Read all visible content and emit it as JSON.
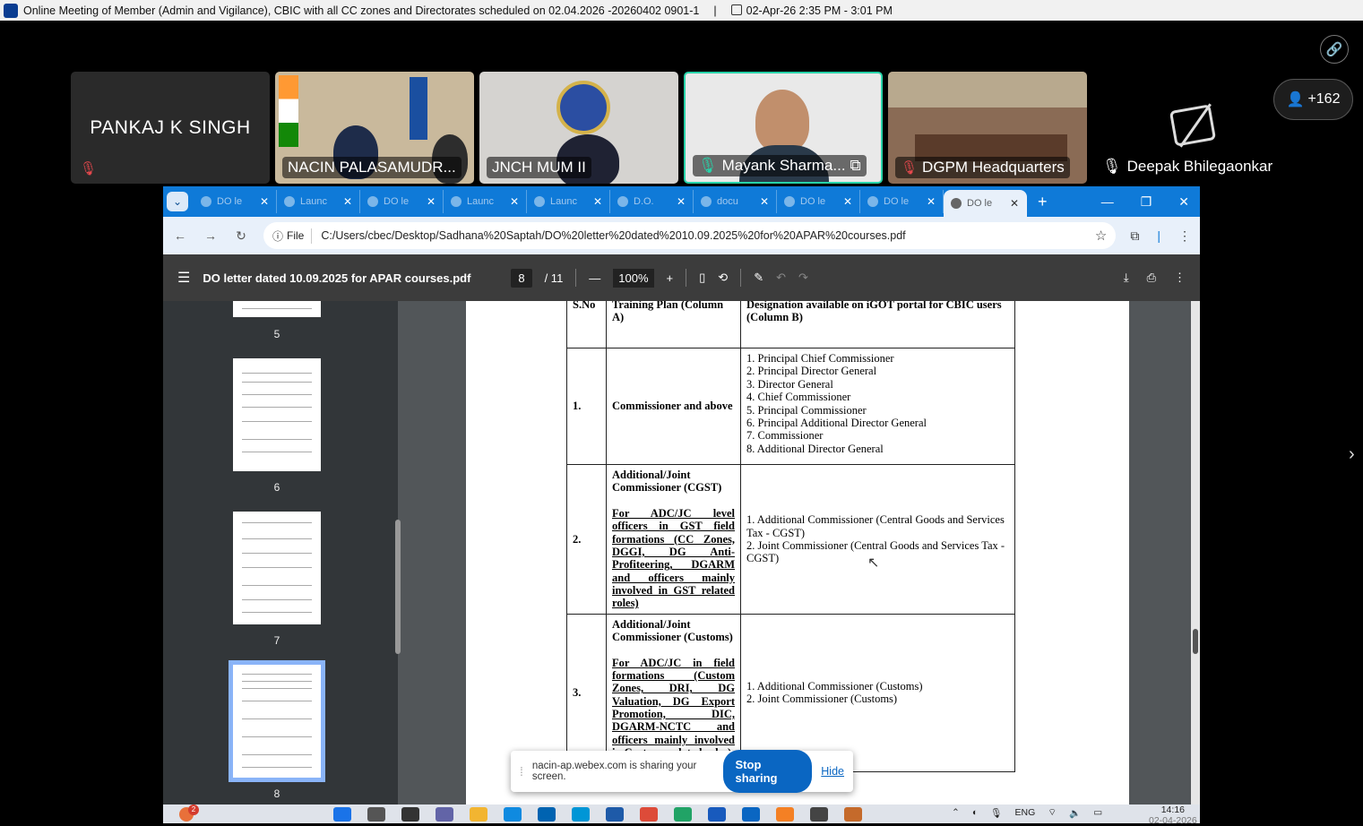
{
  "meeting": {
    "title": "Online Meeting of Member (Admin and Vigilance), CBIC with all CC zones and Directorates scheduled on 02.04.2026 -20260402 0901-1",
    "separator": "|",
    "datetime": "02-Apr-26 2:35 PM - 3:01 PM"
  },
  "participants": [
    {
      "name": "PANKAJ K SINGH"
    },
    {
      "name": "NACIN PALASAMUDR..."
    },
    {
      "name": "JNCH MUM II"
    },
    {
      "name": "Mayank Sharma..."
    },
    {
      "name": "DGPM Headquarters"
    },
    {
      "name": "Deepak Bhilegaonkar"
    }
  ],
  "participant_count": "+162",
  "browser": {
    "tabs": [
      "DO le",
      "Launc",
      "DO le",
      "Launc",
      "Launc",
      "D.O.",
      "docu",
      "DO le",
      "DO le",
      "DO le"
    ],
    "active_tab_index": 9,
    "new_tab": "+",
    "url_chip": "File",
    "url": "C:/Users/cbec/Desktop/Sadhana%20Saptah/DO%20letter%20dated%2010.09.2025%20for%20APAR%20courses.pdf"
  },
  "pdf": {
    "doc_title": "DO letter dated 10.09.2025 for APAR courses.pdf",
    "page_current": "8",
    "page_total": "/ 11",
    "zoom": "100%",
    "thumb_labels": [
      "5",
      "6",
      "7",
      "8"
    ],
    "table": {
      "header_sno": "S.No",
      "header_a": "Training Plan (Column A)",
      "header_b": "Designation available on iGOT portal for CBIC users (Column B)",
      "rows": [
        {
          "sno": "1.",
          "a_title": "Commissioner and above",
          "a_note": "",
          "b": [
            "1. Principal Chief Commissioner",
            "2. Principal Director General",
            "3. Director General",
            "4. Chief Commissioner",
            "5. Principal Commissioner",
            "6. Principal Additional Director General",
            "7. Commissioner",
            "8. Additional Director General"
          ]
        },
        {
          "sno": "2.",
          "a_title": "Additional/Joint Commissioner (CGST)",
          "a_note": "For ADC/JC level officers in GST field formations (CC Zones, DGGI, DG Anti-Profiteering, DGARM and officers mainly involved in GST related roles)",
          "b": [
            "1. Additional Commissioner (Central Goods and Services Tax - CGST)",
            "2. Joint Commissioner (Central Goods and Services Tax - CGST)"
          ]
        },
        {
          "sno": "3.",
          "a_title": "Additional/Joint Commissioner (Customs)",
          "a_note": "For ADC/JC in field formations (Custom Zones, DRI, DG Valuation, DG Export Promotion, DIC, DGARM-NCTC and officers mainly involved in Customs related roles)",
          "b": [
            "1. Additional Commissioner (Customs)",
            "2. Joint Commissioner (Customs)"
          ]
        }
      ]
    }
  },
  "share_bar": {
    "message": "nacin-ap.webex.com is sharing your screen.",
    "stop_label": "Stop sharing",
    "hide_label": "Hide"
  },
  "taskbar": {
    "notification_count": "2",
    "language": "ENG",
    "time": "14:16",
    "date": "02-04-2026"
  },
  "colors": {
    "tabstrip": "#0f7ad8",
    "active_speaker": "#27d3a9",
    "stop_button": "#0a66c2",
    "mute": "#e5484d"
  }
}
